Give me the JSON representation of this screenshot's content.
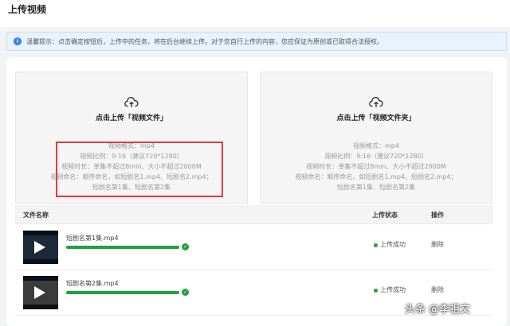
{
  "header": {
    "title": "上传视频"
  },
  "notice": {
    "icon": "info-icon",
    "text": "温馨提示：点击确定按钮后，上传中的任务，将在后台继续上传。对于您自行上传的内容，您应保证为原创或已取得合法授权。"
  },
  "upload_cards": [
    {
      "title": "点击上传「视频文件」",
      "requirements": [
        "视频格式：mp4",
        "视频比例：9:16（建议720*1280）",
        "视频时长：单集不超过8min、大小不超过2000M",
        "视频命名：顺序命名，如短剧名1.mp4、短剧名2.mp4；",
        "短剧名第1集、短剧名第2集"
      ]
    },
    {
      "title": "点击上传「视频文件夹」",
      "requirements": [
        "视频格式：mp4",
        "视频比例：9:16（建议720*1280）",
        "视频时长：单集不超过8min、大小不超过2000M",
        "视频命名：顺序命名，如短剧名1.mp4、短剧名2.mp4；",
        "短剧名第1集、短剧名第2集"
      ]
    }
  ],
  "table": {
    "columns": [
      "文件名称",
      "上传状态",
      "操作"
    ],
    "rows": [
      {
        "filename": "短剧名第1集.mp4",
        "progress": 1.0,
        "status": "上传成功",
        "action": "删除"
      },
      {
        "filename": "短剧名第2集.mp4",
        "progress": 1.0,
        "status": "上传成功",
        "action": "删除"
      }
    ]
  },
  "watermark": "头条 @李祖文",
  "colors": {
    "accent": "#2f7ef7",
    "success": "#1fa23b",
    "highlight": "#e03c3c"
  }
}
